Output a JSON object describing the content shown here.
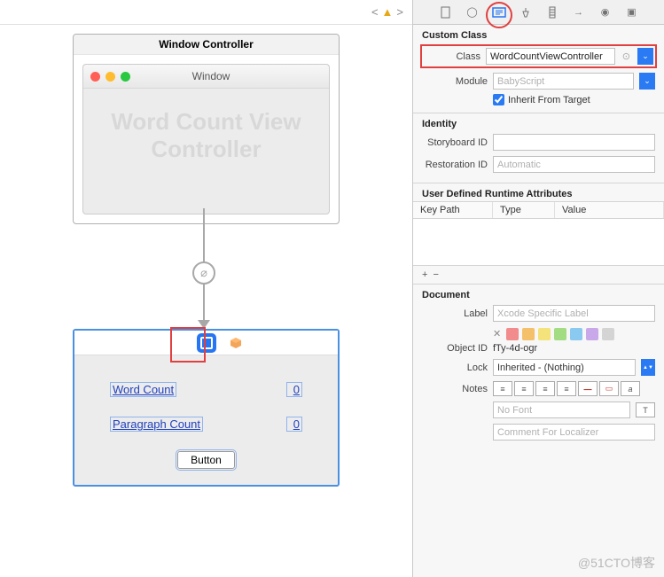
{
  "canvas": {
    "window_controller_title": "Window Controller",
    "window_title": "Window",
    "placeholder": "Word Count View Controller"
  },
  "view": {
    "word_count_label": "Word Count",
    "word_count_value": "0",
    "paragraph_count_label": "Paragraph Count",
    "paragraph_count_value": "0",
    "button_label": "Button"
  },
  "inspector": {
    "custom_class_header": "Custom Class",
    "class_label": "Class",
    "class_value": "WordCountViewController",
    "module_label": "Module",
    "module_placeholder": "BabyScript",
    "inherit_label": "Inherit From Target",
    "identity_header": "Identity",
    "storyboard_label": "Storyboard ID",
    "restoration_label": "Restoration ID",
    "restoration_placeholder": "Automatic",
    "runtime_header": "User Defined Runtime Attributes",
    "col_keypath": "Key Path",
    "col_type": "Type",
    "col_value": "Value",
    "document_header": "Document",
    "doc_label_label": "Label",
    "doc_label_placeholder": "Xcode Specific Label",
    "object_id_label": "Object ID",
    "object_id_value": "fTy-4d-ogr",
    "lock_label": "Lock",
    "lock_value": "Inherited - (Nothing)",
    "notes_label": "Notes",
    "no_font": "No Font",
    "comment_placeholder": "Comment For Localizer",
    "swatches": [
      "#f28b8b",
      "#f4c06a",
      "#f3e37a",
      "#a3dd83",
      "#8ac9f0",
      "#c9a8ea",
      "#d4d4d4"
    ]
  },
  "watermark": "@51CTO博客"
}
